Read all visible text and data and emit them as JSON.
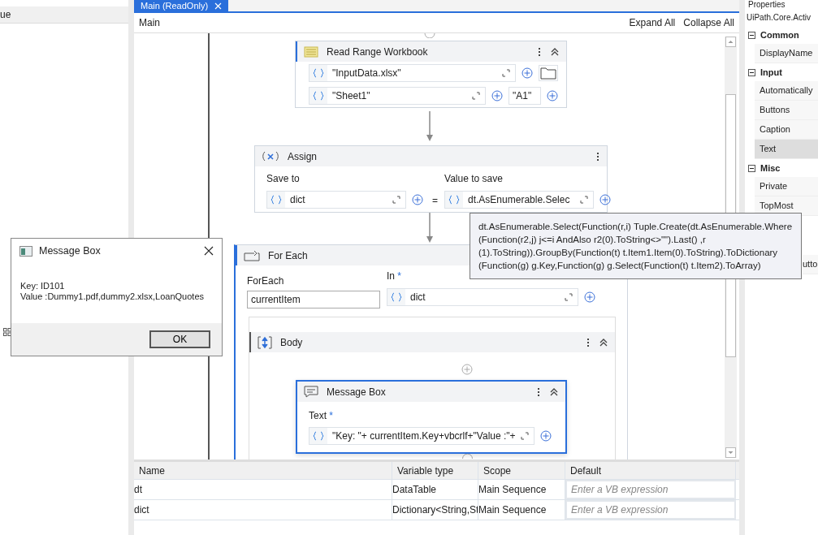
{
  "left_panel": {
    "header": "ue"
  },
  "tab": {
    "label": "Main (ReadOnly)",
    "selected": true
  },
  "designer": {
    "breadcrumb": "Main",
    "expand_all": "Expand All",
    "collapse_all": "Collapse All"
  },
  "read_range": {
    "title": "Read Range Workbook",
    "workbook": "\"InputData.xlsx\"",
    "sheet": "\"Sheet1\"",
    "range": "\"A1\""
  },
  "assign": {
    "title": "Assign",
    "save_to_label": "Save to",
    "save_to": "dict",
    "equals": "=",
    "value_label": "Value to save",
    "value": "dt.AsEnumerable.Selec"
  },
  "for_each": {
    "title": "For Each",
    "item_label": "ForEach",
    "item": "currentItem",
    "in_label": "In",
    "required": "*",
    "in": "dict",
    "body_title": "Body"
  },
  "message_box_activity": {
    "title": "Message Box",
    "text_label": "Text",
    "required": "*",
    "text": "\"Key: \"+ currentItem.Key+vbcrlf+\"Value :\"+"
  },
  "tooltip": {
    "text": "dt.AsEnumerable.Select(Function(r,i) Tuple.Create(dt.AsEnumerable.Where (Function(r2,j) j<=i AndAlso r2(0).ToString<>\"\").Last() ,r (1).ToString)).GroupBy(Function(t) t.Item1.Item(0).ToString).ToDictionary (Function(g) g.Key,Function(g) g.Select(Function(t) t.Item2).ToArray)"
  },
  "dialog": {
    "title": "Message Box",
    "lines": [
      "Key: ID101",
      "Value :Dummy1.pdf,dummy2.xlsx,LoanQuotes"
    ],
    "ok": "OK"
  },
  "variables": {
    "columns": [
      "Name",
      "Variable type",
      "Scope",
      "Default"
    ],
    "rows": [
      {
        "name": "dt",
        "type": "DataTable",
        "scope": "Main Sequence",
        "default_placeholder": "Enter a VB expression"
      },
      {
        "name": "dict",
        "type": "Dictionary<String,St",
        "scope": "Main Sequence",
        "default_placeholder": "Enter a VB expression"
      }
    ]
  },
  "properties": {
    "title": "Properties",
    "type": "UiPath.Core.Activ",
    "groups": [
      {
        "name": "Common",
        "expanded": true,
        "items": [
          {
            "label": "DisplayName",
            "selected": false
          }
        ]
      },
      {
        "name": "Input",
        "expanded": true,
        "items": [
          {
            "label": "Automatically",
            "selected": false
          },
          {
            "label": "Buttons",
            "selected": false
          },
          {
            "label": "Caption",
            "selected": false
          },
          {
            "label": "Text",
            "selected": true
          }
        ]
      },
      {
        "name": "Misc",
        "expanded": true,
        "items": [
          {
            "label": "Private",
            "selected": false
          },
          {
            "label": "TopMost",
            "selected": false
          }
        ]
      }
    ],
    "trailing_value": "utto"
  }
}
